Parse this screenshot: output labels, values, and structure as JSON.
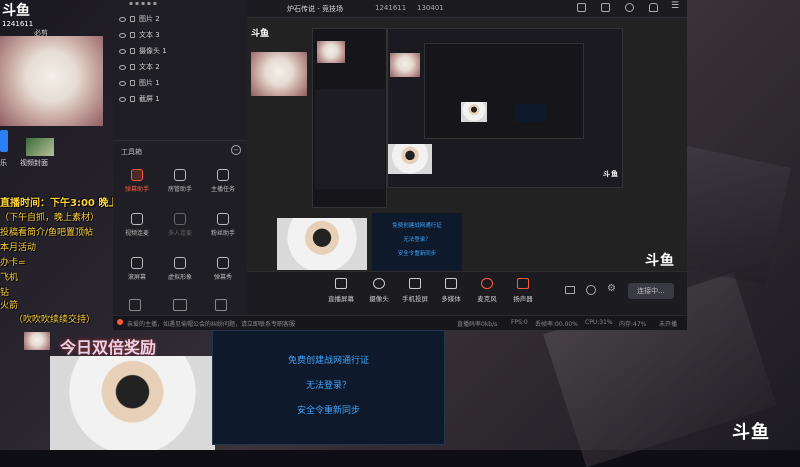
{
  "overlay": {
    "brand_logo": "斗鱼",
    "room_number": "1241611",
    "cat_caption": "必剪",
    "desktop_icon1_label": "乐",
    "desktop_icon2_label": "视频封面",
    "schedule_lines": [
      "直播时间：下午3:00 晚上10:00",
      "（下午自抓，晚上素材）",
      "投稿看简介/鱼吧置顶帖",
      "本月活动",
      "办卡=",
      "飞机",
      "钻",
      "火箭",
      "（吹吹吹续续交持）"
    ],
    "banner_text": "今日双倍奖励"
  },
  "layers": {
    "items": [
      {
        "label": "图片 2"
      },
      {
        "label": "文本 3"
      },
      {
        "label": "摄像头 1"
      },
      {
        "label": "文本 2"
      },
      {
        "label": "图片 1"
      },
      {
        "label": "截屏 1"
      }
    ]
  },
  "toolbox": {
    "title": "工具箱",
    "items": [
      {
        "label": "弹幕助手",
        "active": true
      },
      {
        "label": "房管助手",
        "active": false
      },
      {
        "label": "主播任务",
        "active": false
      },
      {
        "label": "视频连麦",
        "active": false
      },
      {
        "label": "多人连麦",
        "active": false
      },
      {
        "label": "粉丝助手",
        "active": false
      },
      {
        "label": "滚屏幕",
        "active": false
      },
      {
        "label": "虚拟形象",
        "active": false
      },
      {
        "label": "弹幕秀",
        "active": false
      }
    ]
  },
  "topbar": {
    "title": "炉石传说 - 竞技场",
    "room_id": "1241611",
    "followers": "130401"
  },
  "bottombar": {
    "items": [
      {
        "label": "直播屏幕"
      },
      {
        "label": "摄像头"
      },
      {
        "label": "手机投屏"
      },
      {
        "label": "多媒体"
      },
      {
        "label": "麦克风"
      },
      {
        "label": "扬声器"
      }
    ],
    "start_button": "连接中..."
  },
  "statusbar": {
    "notice": "亲爱的主播，如遇见偷帽公会的纠纷问题，请立即联系专职客服",
    "bitrate": "直播码率0kb/s",
    "fps": "FPS:0",
    "drop": "丢帧率:00.00%",
    "cpu": "CPU:31%",
    "mem": "内存:47%",
    "state": "未开播"
  },
  "info_panel": {
    "line1": "免费创建战网通行证",
    "line2": "无法登录？",
    "line3": "安全令重新同步"
  },
  "colors": {
    "accent": "#ff5a3c",
    "link_blue": "#3da4ff",
    "overlay_yellow": "#ffd23a"
  }
}
